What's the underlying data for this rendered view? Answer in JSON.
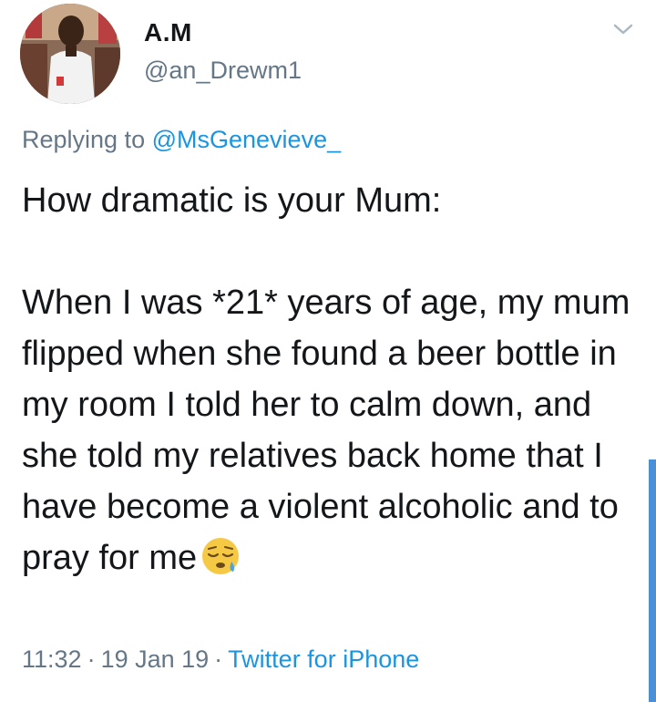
{
  "user": {
    "display_name": "A.M",
    "handle": "@an_Drewm1",
    "avatar_icon": "profile-photo"
  },
  "reply": {
    "prefix": "Replying to",
    "target": "@MsGenevieve_"
  },
  "tweet": {
    "title_line": "How dramatic is your Mum:",
    "body": "When I was *21* years of age, my mum flipped when she found a beer bottle in my room I told her to calm down, and she told my relatives back home that I have become a violent alcoholic and to pray for me",
    "emoji_icon": "sleepy-face-emoji"
  },
  "meta": {
    "time": "11:32",
    "separator": "·",
    "date": "19 Jan 19",
    "source": "Twitter for iPhone"
  },
  "icons": {
    "menu": "chevron-down-icon"
  },
  "colors": {
    "text": "#14171a",
    "secondary": "#657786",
    "link": "#1b95e0",
    "scroll": "#4a90d9"
  }
}
